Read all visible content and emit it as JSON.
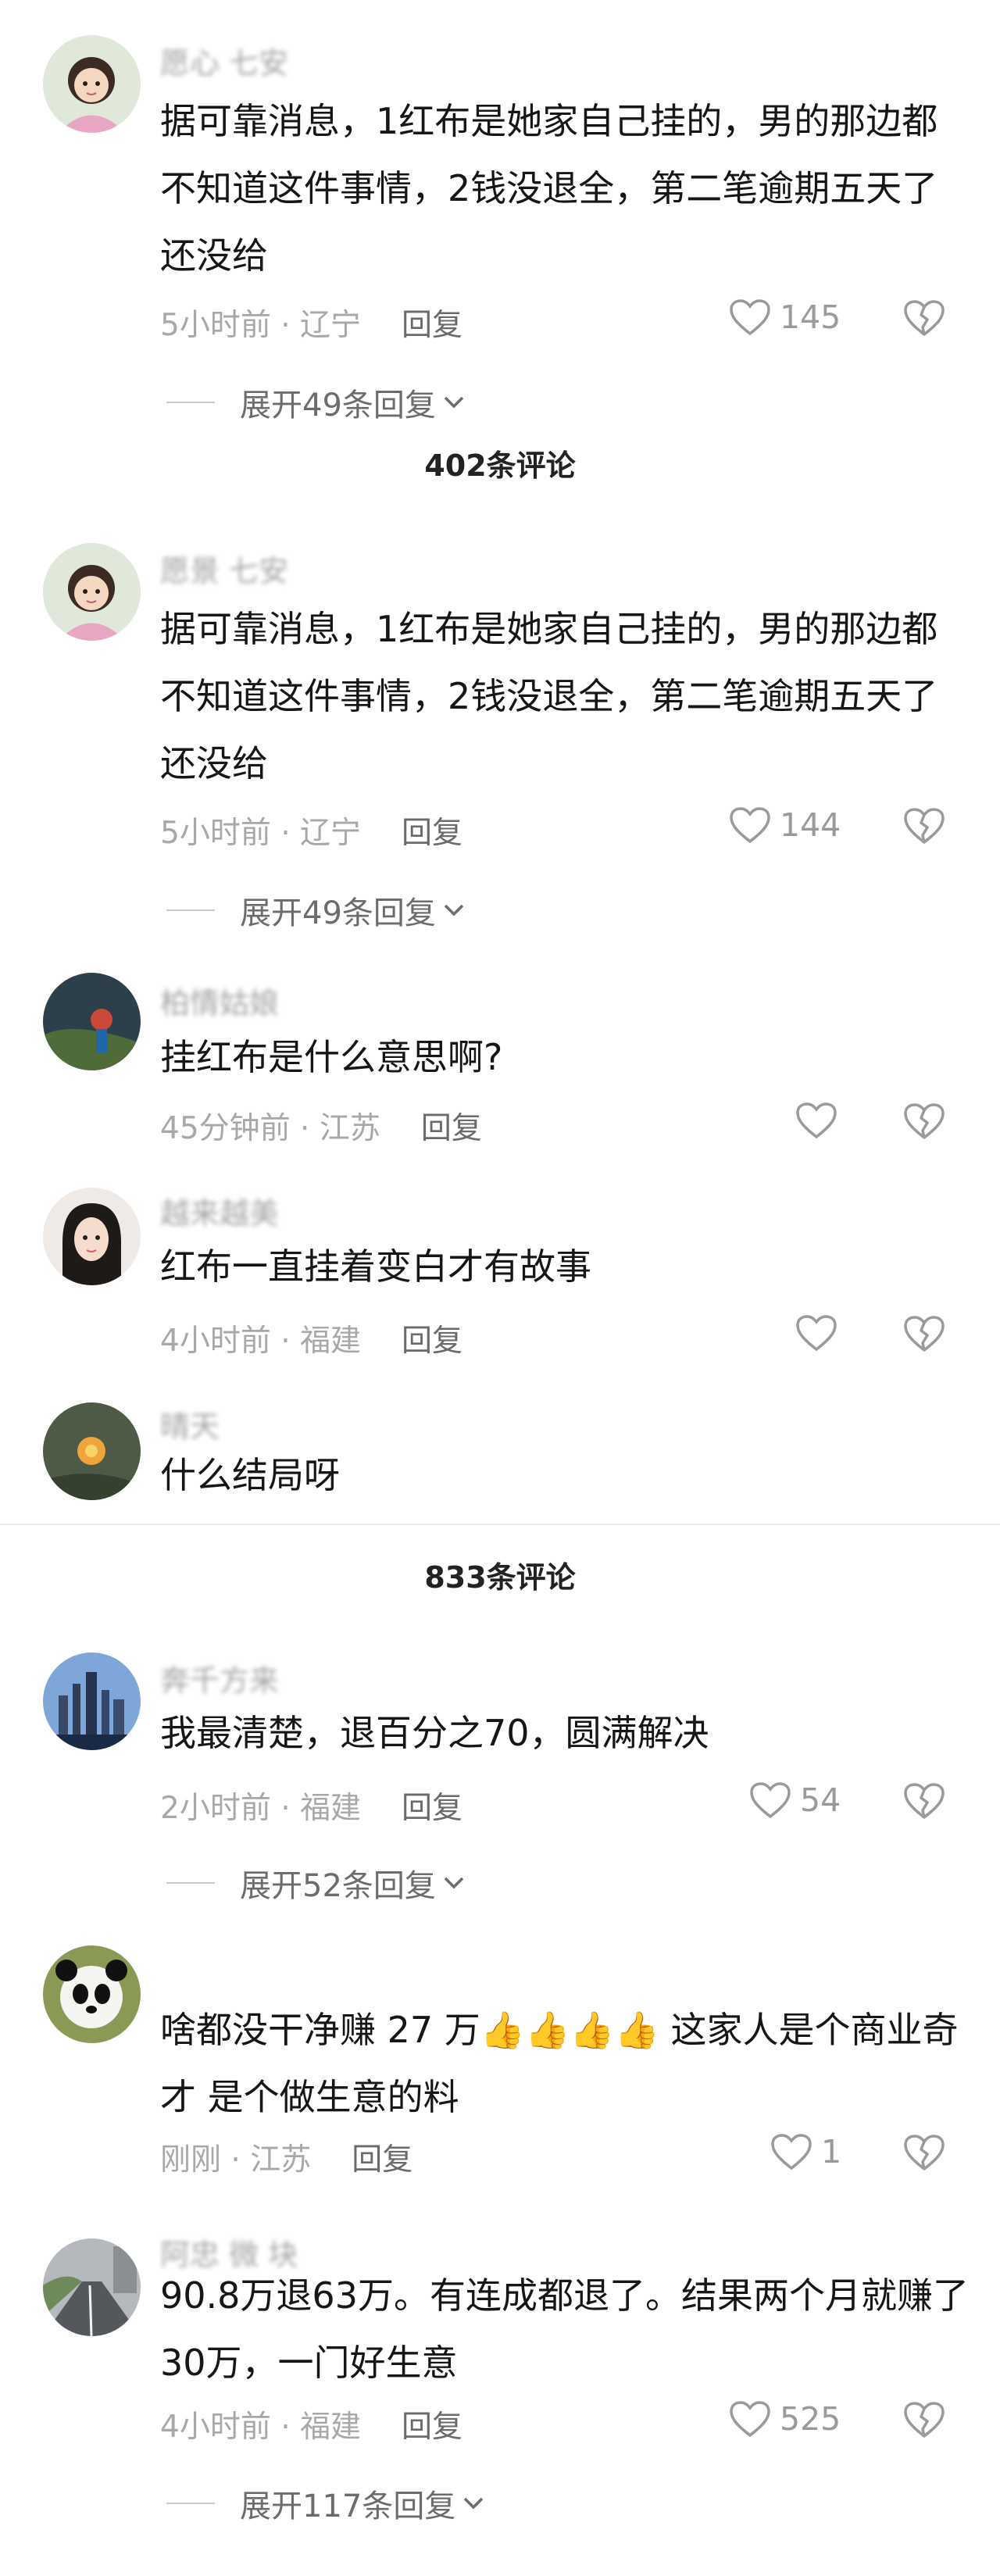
{
  "comments": [
    {
      "user": "愿心 七安",
      "text": "据可靠消息，1红布是她家自己挂的，男的那边都不知道这件事情，2钱没退全，第二笔逾期五天了还没给",
      "time": "5小时前",
      "location": "辽宁",
      "reply_label": "回复",
      "likes": "145",
      "expand": "展开49条回复"
    },
    {
      "user": "愿景 七安",
      "text": "据可靠消息，1红布是她家自己挂的，男的那边都不知道这件事情，2钱没退全，第二笔逾期五天了还没给",
      "time": "5小时前",
      "location": "辽宁",
      "reply_label": "回复",
      "likes": "144",
      "expand": "展开49条回复"
    },
    {
      "user": "柏情姑娘",
      "text": "挂红布是什么意思啊?",
      "time": "45分钟前",
      "location": "江苏",
      "reply_label": "回复",
      "likes": ""
    },
    {
      "user": "越来越美",
      "text": "红布一直挂着变白才有故事",
      "time": "4小时前",
      "location": "福建",
      "reply_label": "回复",
      "likes": ""
    },
    {
      "user": "晴天",
      "text": "什么结局呀"
    },
    {
      "user": "奔千方来",
      "text": "我最清楚，退百分之70，圆满解决",
      "time": "2小时前",
      "location": "福建",
      "reply_label": "回复",
      "likes": "54",
      "expand": "展开52条回复"
    },
    {
      "user": "",
      "text_before": "啥都没干净赚 27 万",
      "emoji": "👍👍👍👍",
      "text_after": " 这家人是个商业奇才 是个做生意的料",
      "time": "刚刚",
      "location": "江苏",
      "reply_label": "回复",
      "likes": "1"
    },
    {
      "user": "阿忠 微 块",
      "text": "90.8万退63万。有连成都退了。结果两个月就赚了30万，一门好生意",
      "time": "4小时前",
      "location": "福建",
      "reply_label": "回复",
      "likes": "525",
      "expand": "展开117条回复"
    }
  ],
  "counts": {
    "first": "402条评论",
    "second": "833条评论"
  },
  "separator": " · ",
  "icons": {
    "like": "heart-outline-icon",
    "dislike": "broken-heart-icon",
    "expand": "chevron-down-icon"
  },
  "colors": {
    "meta_gray": "#a8a8a8",
    "text": "#161616",
    "reply": "#6a6a6a"
  }
}
